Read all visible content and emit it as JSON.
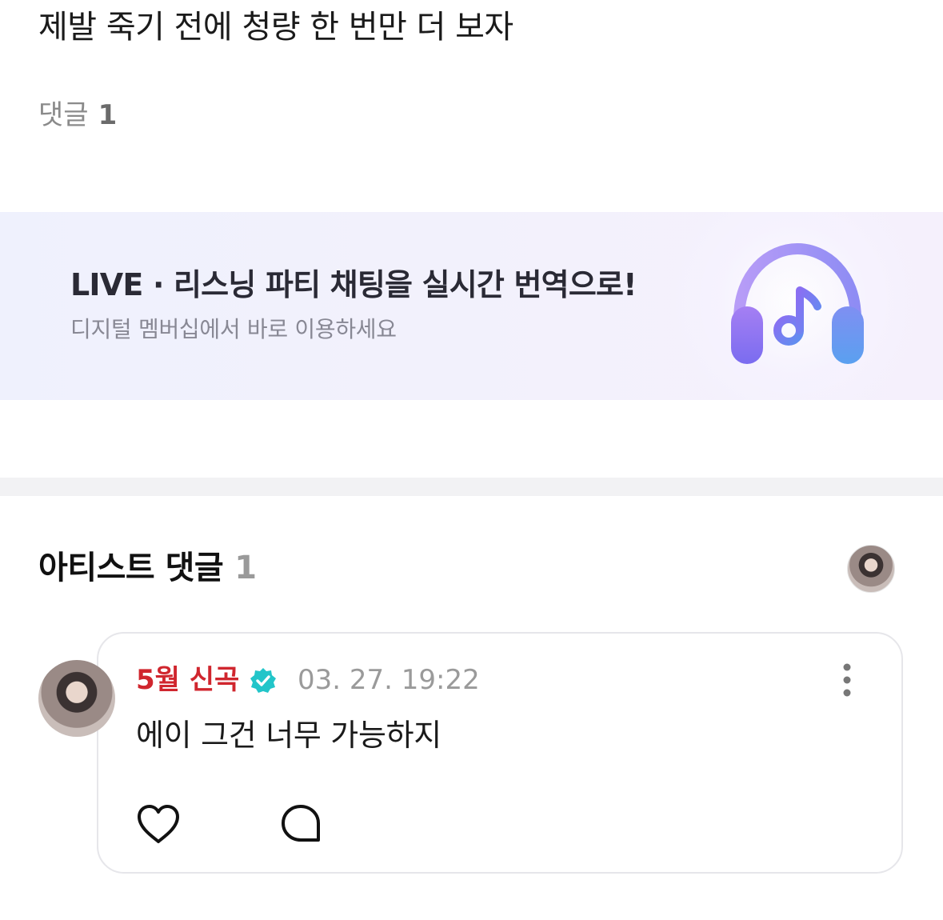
{
  "post": {
    "text": "제발 죽기 전에 청량 한 번만 더 보자"
  },
  "comments_summary": {
    "label": "댓글",
    "count": "1"
  },
  "banner": {
    "title": "LIVE · 리스닝 파티 채팅을 실시간 번역으로!",
    "subtitle": "디지털 멤버십에서 바로 이용하세요",
    "icon": "headphones-music-icon",
    "accent_colors": [
      "#7b6cf6",
      "#a07cf2",
      "#5fa0f0"
    ]
  },
  "artist_comments": {
    "heading": "아티스트 댓글",
    "count": "1",
    "items": [
      {
        "author": "5월 신곡",
        "verified": true,
        "verified_color": "#22c5c9",
        "author_color": "#d0262e",
        "timestamp": "03. 27. 19:22",
        "text": "에이 그건 너무 가능하지",
        "actions": [
          "heart-icon",
          "reply-bubble-icon"
        ],
        "menu_icon": "more-vertical-icon"
      }
    ]
  }
}
